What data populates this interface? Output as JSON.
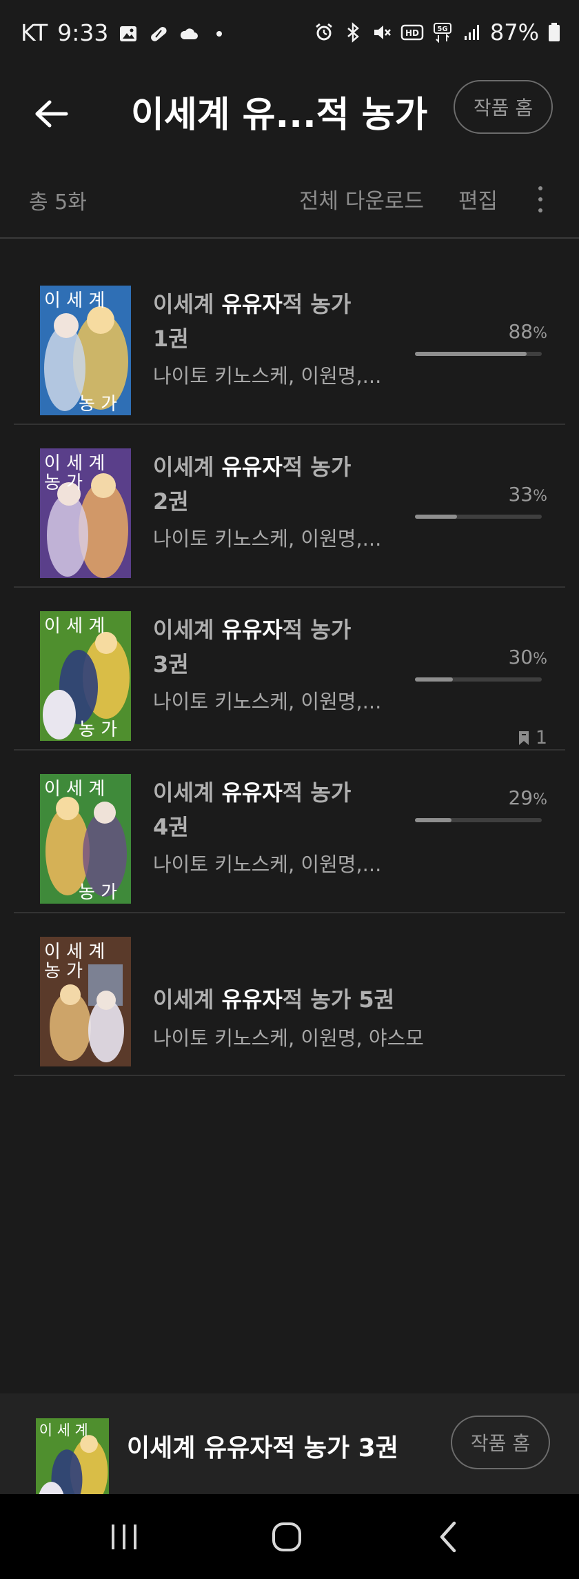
{
  "status_bar": {
    "carrier": "KT",
    "time": "9:33",
    "left_icons": [
      "gallery-icon",
      "pill-icon",
      "cloud-icon",
      "dot-icon"
    ],
    "right_icons": [
      "alarm-icon",
      "bluetooth-icon",
      "mute-icon",
      "hd-icon",
      "5g-icon",
      "signal-icon",
      "battery-icon"
    ],
    "hd_label": "HD",
    "fiveg_label": "5G",
    "battery": "87%"
  },
  "app_bar": {
    "title": "이세계 유...적 농가",
    "home_button": "작품 홈"
  },
  "toolbar": {
    "total": "총 5화",
    "download_all": "전체 다운로드",
    "edit": "편집"
  },
  "books": [
    {
      "title_pre": "이세계 ",
      "title_hl": "유유자",
      "title_post": "적 농가",
      "title_line2": "1권",
      "authors": "나이토 키노스케, 이원명,...",
      "progress": 88,
      "progress_label": "88",
      "pct_sign": "%",
      "bookmark_count": null,
      "cover_colors": [
        "#2f6fb5",
        "#e8c25a",
        "#c9d6e8"
      ]
    },
    {
      "title_pre": "이세계 ",
      "title_hl": "유유자",
      "title_post": "적 농가",
      "title_line2": "2권",
      "authors": "나이토 키노스케, 이원명,...",
      "progress": 33,
      "progress_label": "33",
      "pct_sign": "%",
      "bookmark_count": null,
      "cover_colors": [
        "#5a3f8a",
        "#e6a861",
        "#d9d0e8"
      ]
    },
    {
      "title_pre": "이세계 ",
      "title_hl": "유유자",
      "title_post": "적 농가",
      "title_line2": "3권",
      "authors": "나이토 키노스케, 이원명,...",
      "progress": 30,
      "progress_label": "30",
      "pct_sign": "%",
      "bookmark_count": "1",
      "cover_colors": [
        "#4f8f2e",
        "#e8c24a",
        "#2f3f7a"
      ]
    },
    {
      "title_pre": "이세계 ",
      "title_hl": "유유자",
      "title_post": "적 농가",
      "title_line2": "4권",
      "authors": "나이토 키노스케, 이원명,...",
      "progress": 29,
      "progress_label": "29",
      "pct_sign": "%",
      "bookmark_count": null,
      "cover_colors": [
        "#3f8a3a",
        "#e6b55a",
        "#6a4a8a"
      ]
    },
    {
      "title_pre": "이세계 ",
      "title_hl": "유유자",
      "title_post": "적 농가 5권",
      "title_line2": "",
      "authors": "나이토 키노스케, 이원명, 야스모",
      "progress": null,
      "progress_label": "",
      "pct_sign": "",
      "bookmark_count": null,
      "cover_colors": [
        "#5a3a2a",
        "#d9b070",
        "#8aa0c0"
      ]
    }
  ],
  "mini_player": {
    "title": "이세계 유유자적 농가 3권",
    "home_button": "작품 홈"
  },
  "nav_bar": {
    "buttons": [
      "recent-apps-icon",
      "home-icon",
      "back-nav-icon"
    ]
  },
  "cover_lettering": [
    "이 세 계",
    "농 가"
  ],
  "colors": {
    "background": "#1b1b1b",
    "highlight_text": "#ffffff",
    "muted_text": "#8c8c8c",
    "progress_fill": "#8f8f8f",
    "progress_track": "#3f3f3f"
  }
}
